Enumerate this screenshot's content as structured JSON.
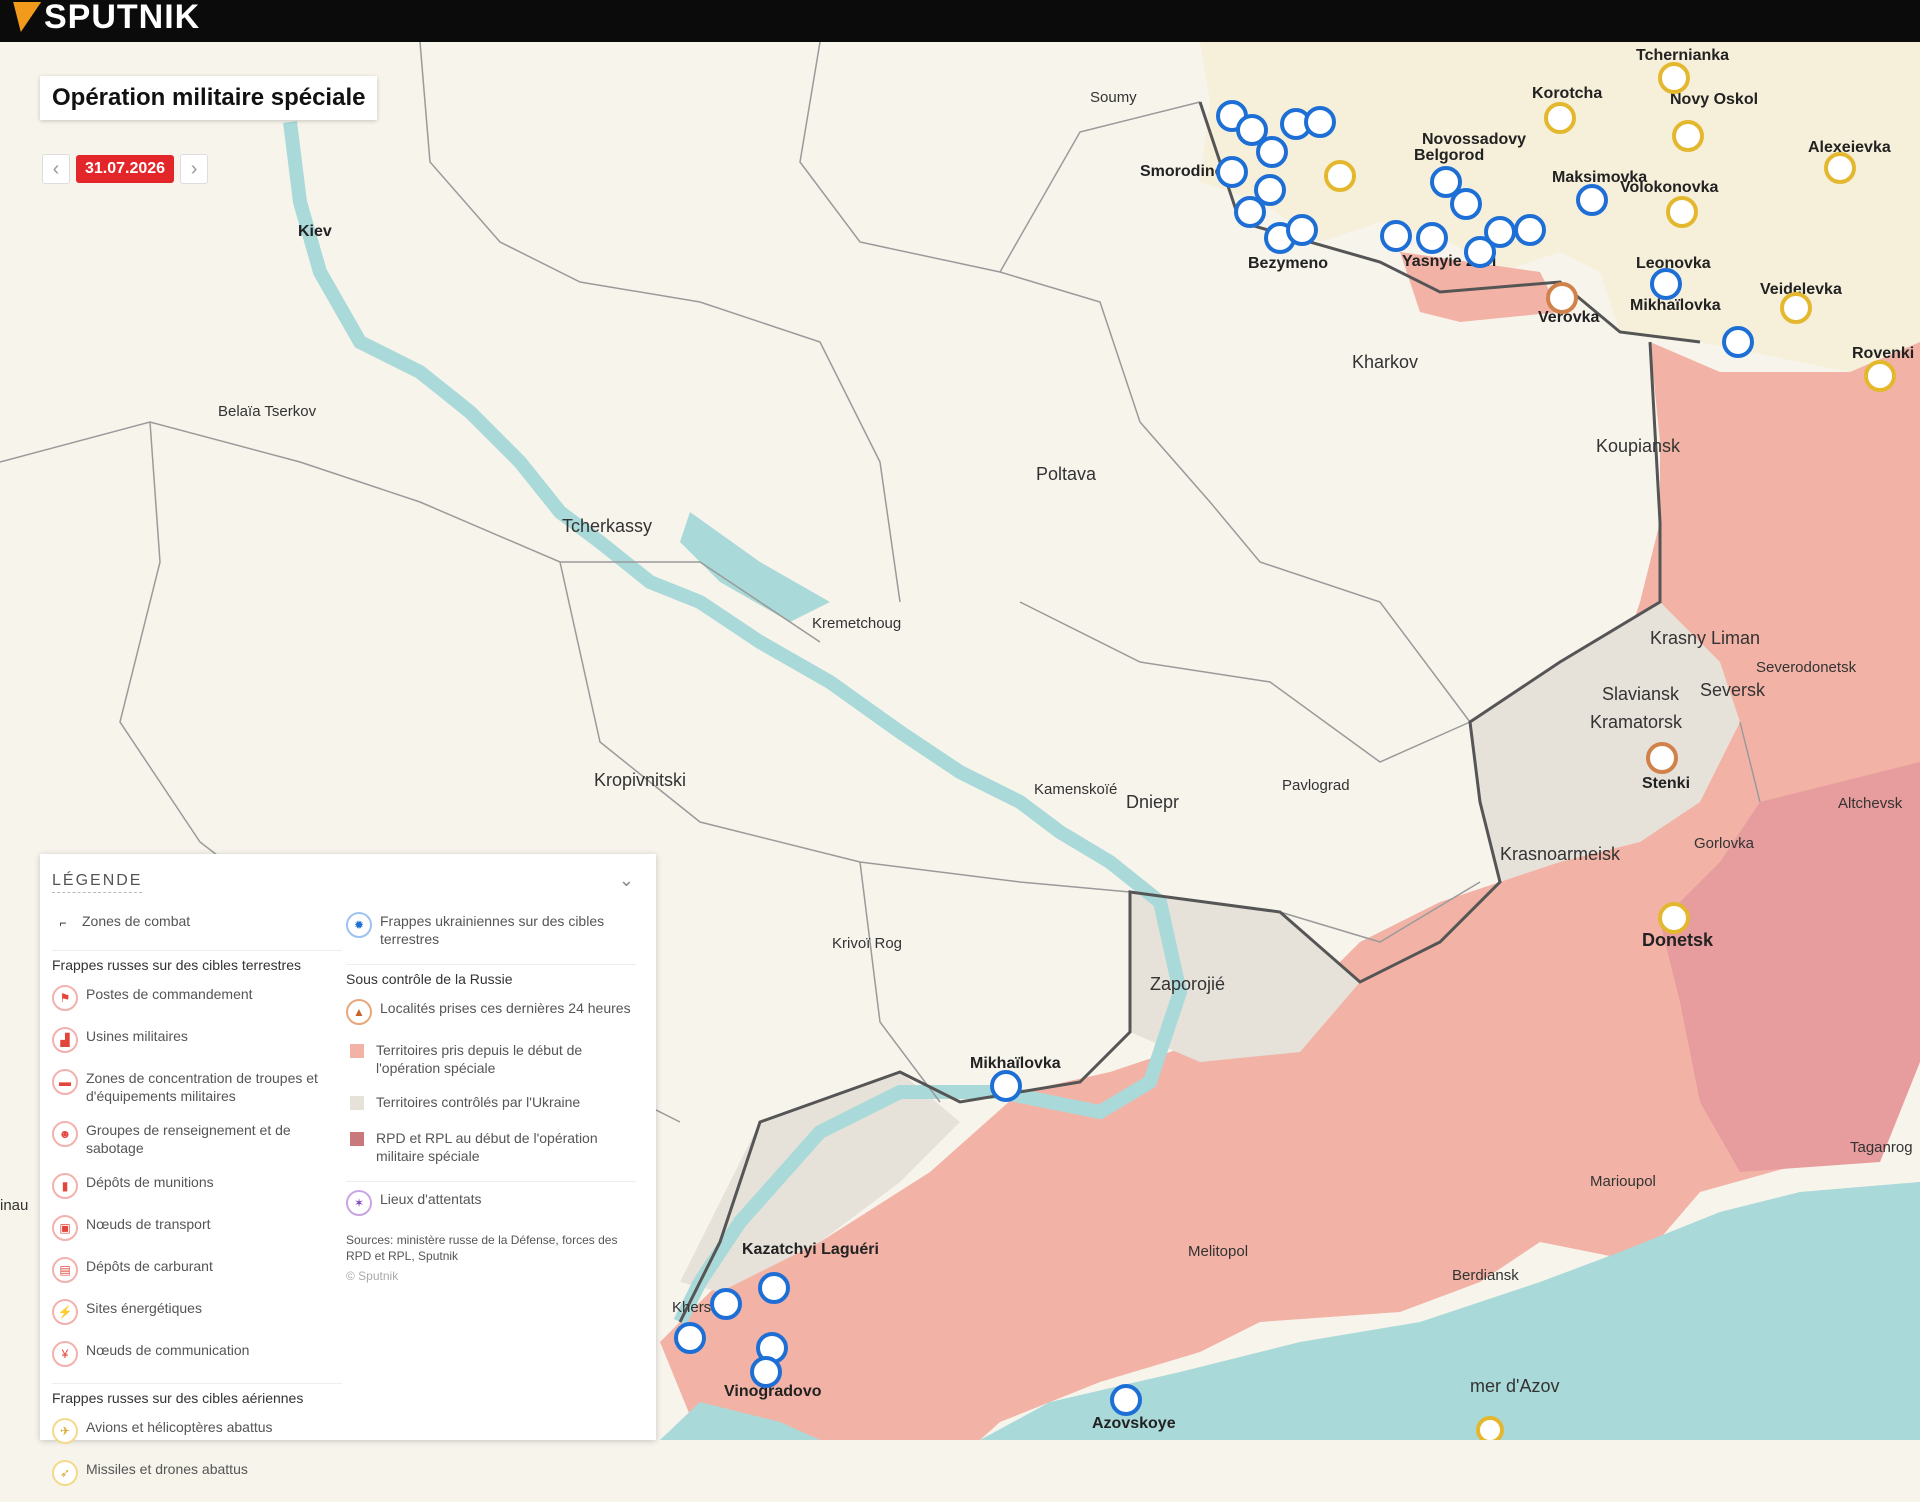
{
  "header": {
    "brand": "SPUTNIK"
  },
  "map": {
    "title": "Opération militaire spéciale",
    "date": "31.07.2026",
    "colors": {
      "land": "#f7f4ec",
      "water": "#a9d9d8",
      "russia": "#f6efd9",
      "taken": "#f2b3a6",
      "ukraine_ctrl": "#e6e2da",
      "rpd": "#e79c9d",
      "strike_blue": "#1d6fd6",
      "air_yellow": "#e4b82e"
    },
    "places": [
      {
        "name": "Soumy",
        "type": "city"
      },
      {
        "name": "Kiev",
        "type": "capital"
      },
      {
        "name": "Belaïa Tserkov",
        "type": "city"
      },
      {
        "name": "Tcherkassy",
        "type": "city"
      },
      {
        "name": "Kremetchoug",
        "type": "city"
      },
      {
        "name": "Poltava",
        "type": "city"
      },
      {
        "name": "Kropivnitski",
        "type": "city"
      },
      {
        "name": "Kamenskoïé",
        "type": "city"
      },
      {
        "name": "Dniepr",
        "type": "city"
      },
      {
        "name": "Pavlograd",
        "type": "city"
      },
      {
        "name": "Krivoï Rog",
        "type": "city"
      },
      {
        "name": "Zaporojié",
        "type": "city"
      },
      {
        "name": "Kherson",
        "type": "city"
      },
      {
        "name": "Melitopol",
        "type": "city"
      },
      {
        "name": "Berdiansk",
        "type": "city"
      },
      {
        "name": "Marioupol",
        "type": "city"
      },
      {
        "name": "Donetsk",
        "type": "city"
      },
      {
        "name": "Gorlovka",
        "type": "city"
      },
      {
        "name": "Altchevsk",
        "type": "city"
      },
      {
        "name": "Severodonetsk",
        "type": "city"
      },
      {
        "name": "Kramatorsk",
        "type": "city"
      },
      {
        "name": "Slaviansk",
        "type": "city"
      },
      {
        "name": "Seversk",
        "type": "city"
      },
      {
        "name": "Krasny Liman",
        "type": "city"
      },
      {
        "name": "Krasnoarmeisk",
        "type": "city"
      },
      {
        "name": "Koupiansk",
        "type": "city"
      },
      {
        "name": "Kharkov",
        "type": "city"
      },
      {
        "name": "Belgorod",
        "type": "city"
      },
      {
        "name": "Taganrog",
        "type": "city"
      },
      {
        "name": "mer d'Azov",
        "type": "sea"
      },
      {
        "name": "Smorodino",
        "type": "village"
      },
      {
        "name": "Bezymeno",
        "type": "village"
      },
      {
        "name": "Novossadovy",
        "type": "village"
      },
      {
        "name": "Yasnyie Zori",
        "type": "village"
      },
      {
        "name": "Maksimovka",
        "type": "village"
      },
      {
        "name": "Korotcha",
        "type": "village"
      },
      {
        "name": "Tchernianka",
        "type": "village"
      },
      {
        "name": "Novy Oskol",
        "type": "village"
      },
      {
        "name": "Volokonovka",
        "type": "village"
      },
      {
        "name": "Alexeievka",
        "type": "village"
      },
      {
        "name": "Leonovka",
        "type": "village"
      },
      {
        "name": "Mikhaïlovka",
        "type": "village"
      },
      {
        "name": "Veidelevka",
        "type": "village"
      },
      {
        "name": "Rovenki",
        "type": "village"
      },
      {
        "name": "Verovka",
        "type": "village"
      },
      {
        "name": "Stenki",
        "type": "village"
      },
      {
        "name": "Mikhaïlovka",
        "type": "village"
      },
      {
        "name": "Kazatchyi Laguéri",
        "type": "village"
      },
      {
        "name": "Vinogradovo",
        "type": "village"
      },
      {
        "name": "Azovskoye",
        "type": "village"
      },
      {
        "name": "inau",
        "type": "fragment"
      }
    ]
  },
  "legend": {
    "title": "LÉGENDE",
    "combat": "Zones de combat",
    "ground_title": "Frappes russes sur des cibles terrestres",
    "ground": [
      "Postes de commandement",
      "Usines militaires",
      "Zones de concentration de troupes et d'équipements militaires",
      "Groupes de renseignement et de sabotage",
      "Dépôts de munitions",
      "Nœuds de transport",
      "Dépôts de carburant",
      "Sites énergétiques",
      "Nœuds de communication"
    ],
    "air_title": "Frappes russes sur des cibles aériennes",
    "air": [
      "Avions et hélicoptères abattus",
      "Missiles et drones abattus"
    ],
    "ukr_strikes": "Frappes ukrainiennes sur des cibles terrestres",
    "control_title": "Sous contrôle de la Russie",
    "control": [
      "Localités prises ces dernières 24 heures",
      "Territoires pris depuis le début de l'opération spéciale",
      "Territoires contrôlés par l'Ukraine",
      "RPD et RPL au début de l'opération militaire spéciale"
    ],
    "attacks": "Lieux d'attentats",
    "sources": "Sources: ministère russe de la Défense, forces des RPD et RPL, Sputnik",
    "copyright": "© Sputnik"
  }
}
